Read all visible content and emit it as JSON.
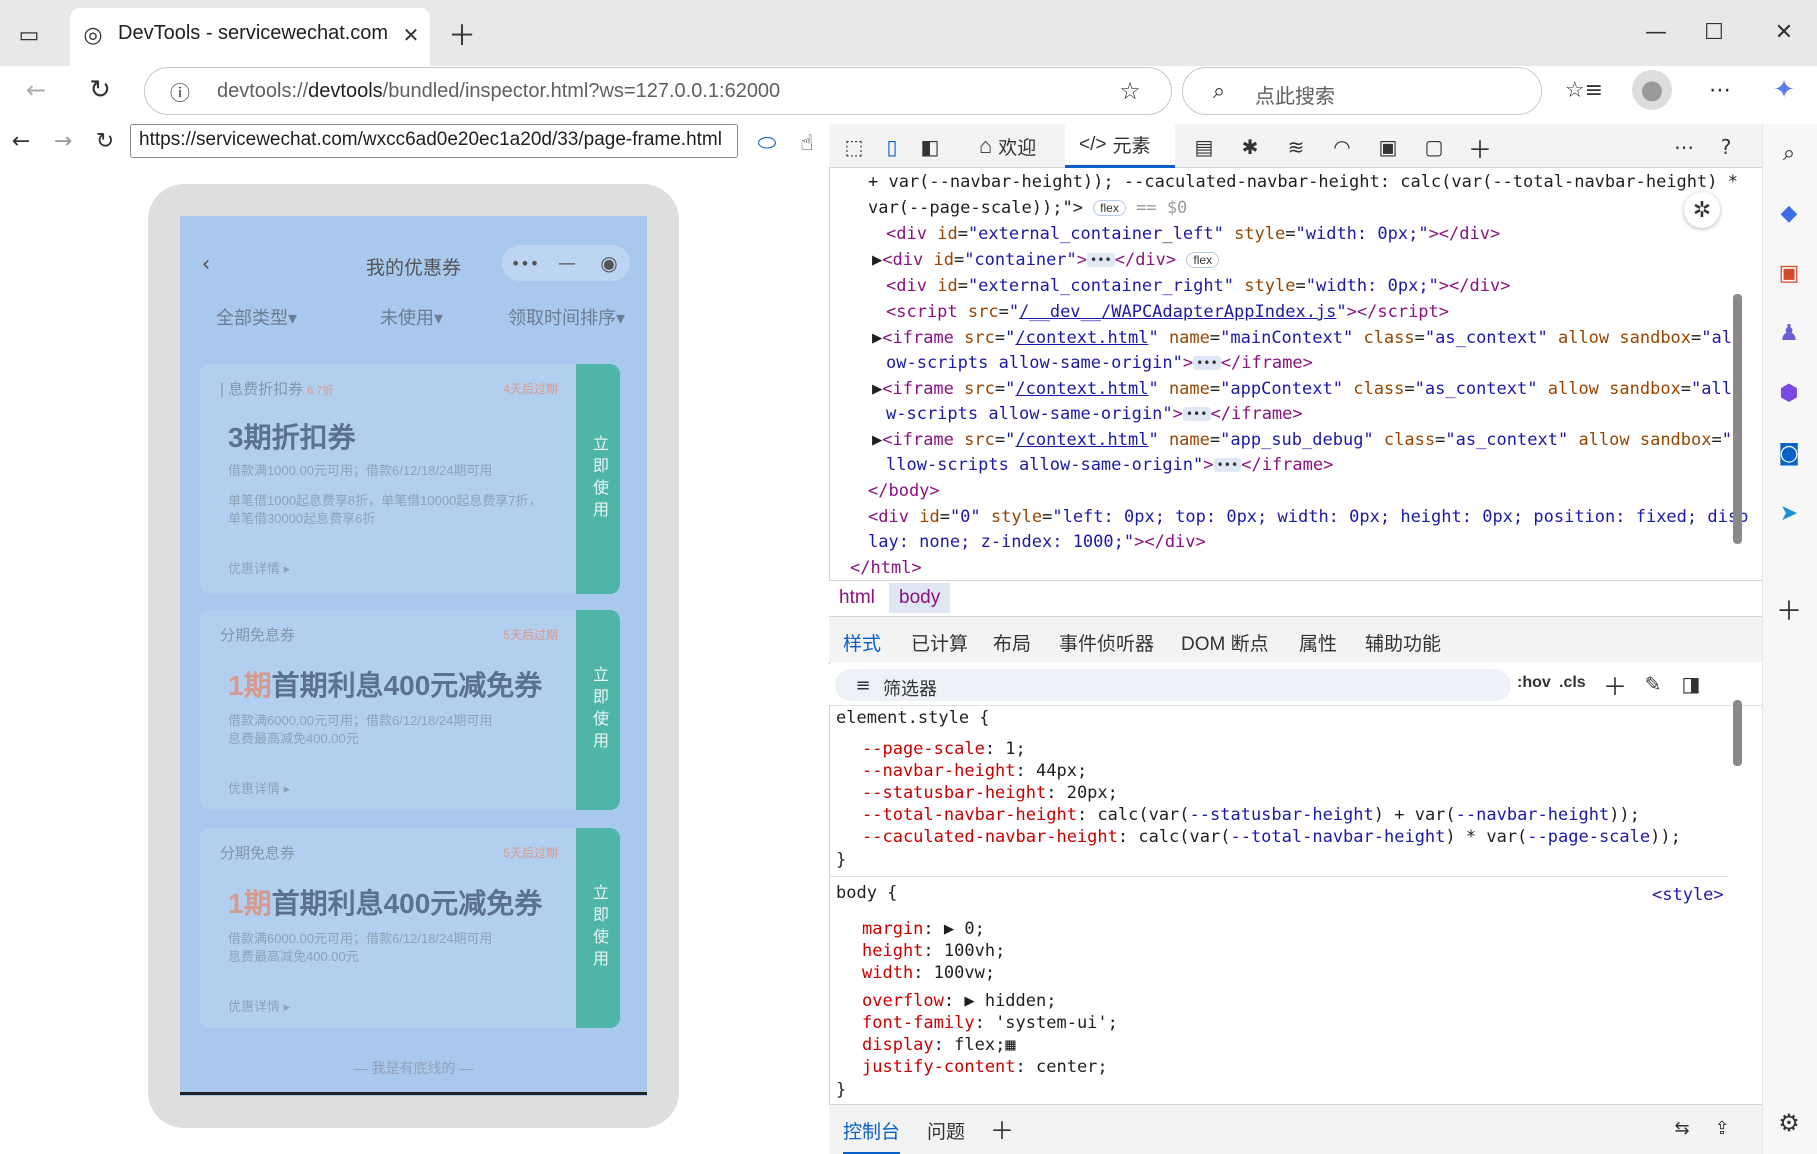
{
  "browser": {
    "tab_title": "DevTools - servicewechat.com/wx",
    "address": "devtools://devtools/bundled/inspector.html?ws=127.0.0.1:62000",
    "address_prefix": "devtools://",
    "address_host": "devtools",
    "address_rest": "/bundled/inspector.html?ws=127.0.0.1:62000",
    "search_placeholder": "点此搜索"
  },
  "simulator": {
    "url": "https://servicewechat.com/wxcc6ad0e20ec1a20d/33/page-frame.html",
    "page_title": "我的优惠券",
    "filters": [
      "全部类型▾",
      "未使用▾",
      "领取时间排序▾"
    ],
    "use_label": "立即使用",
    "detail_label": "优惠详情 ▸",
    "coupons": [
      {
        "tag": "息费折扣券",
        "badge": "6.7折",
        "expiry": "4天后过期",
        "title_hl": "",
        "title": "3期折扣券",
        "line1": "借款满1000.00元可用；借款6/12/18/24期可用",
        "line2": "单笔借1000起息费享8折，单笔借10000起息费享7折，",
        "line3": "单笔借30000起息费享6折"
      },
      {
        "tag": "分期免息券",
        "badge": "",
        "expiry": "5天后过期",
        "title_hl": "1期",
        "title": "首期利息400元减免券",
        "line1": "借款满6000.00元可用；借款6/12/18/24期可用",
        "line2": "息费最高减免400.00元",
        "line3": ""
      },
      {
        "tag": "分期免息券",
        "badge": "",
        "expiry": "5天后过期",
        "title_hl": "1期",
        "title": "首期利息400元减免券",
        "line1": "借款满6000.00元可用；借款6/12/18/24期可用",
        "line2": "息费最高减免400.00元",
        "line3": ""
      }
    ],
    "footer": "— 我是有底线的 —"
  },
  "devtools": {
    "tabs": {
      "welcome": "欢迎",
      "elements": "元素"
    },
    "breadcrumb": [
      "html",
      "body"
    ],
    "style_tabs": [
      "样式",
      "已计算",
      "布局",
      "事件侦听器",
      "DOM 断点",
      "属性",
      "辅助功能"
    ],
    "filter_placeholder": "筛选器",
    "hov": ":hov",
    "cls": ".cls",
    "style_source": "<style>",
    "drawer_tabs": [
      "控制台",
      "问题"
    ]
  }
}
